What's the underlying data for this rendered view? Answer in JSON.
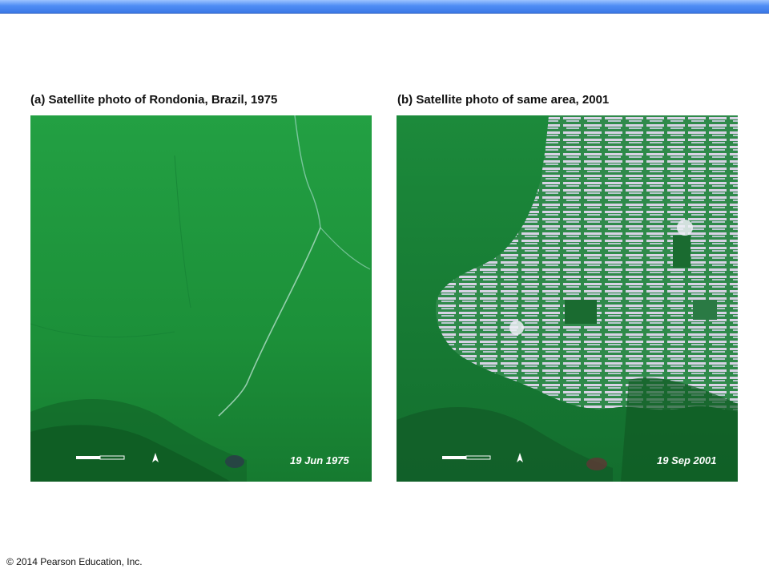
{
  "captions": {
    "a": "(a) Satellite photo of Rondonia, Brazil, 1975",
    "b": "(b) Satellite photo of same area, 2001"
  },
  "photos": {
    "a": {
      "date": "19 Jun 1975"
    },
    "b": {
      "date": "19 Sep 2001"
    }
  },
  "colors": {
    "forest": "#1e8c3a",
    "forest_dark": "#135f2a",
    "cleared": "#d9d4e6",
    "topbar": "#3b78e6"
  },
  "footer": {
    "copyright": "© 2014 Pearson Education, Inc."
  }
}
